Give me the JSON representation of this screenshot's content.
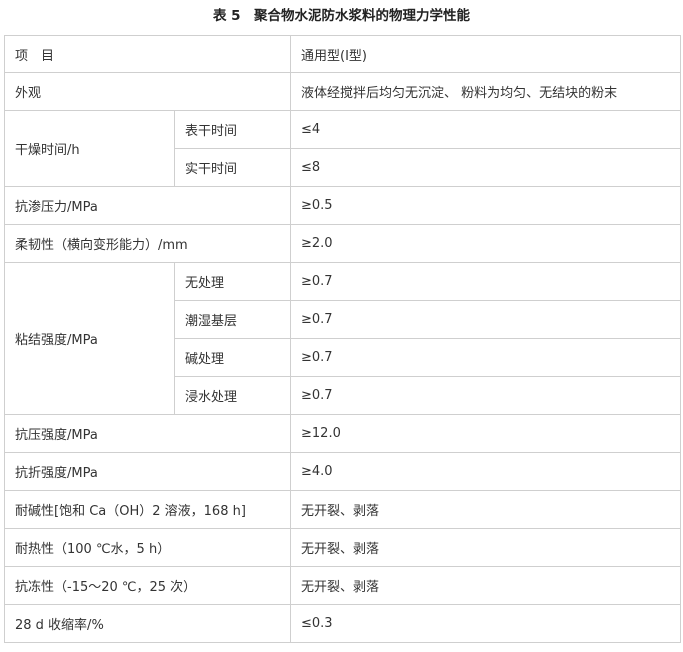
{
  "title": "表 5　聚合物水泥防水浆料的物理力学性能",
  "header": {
    "item": "项　目",
    "type": "通用型(Ⅰ型)"
  },
  "rows": {
    "appearance": {
      "name": "外观",
      "value": "液体经搅拌后均匀无沉淀、 粉料为均匀、无结块的粉末"
    },
    "drying_time": {
      "name": "干燥时间/h",
      "surface_dry": "表干时间",
      "surface_dry_value": "≤4",
      "hard_dry": "实干时间",
      "hard_dry_value": "≤8"
    },
    "impermeability": {
      "name": "抗渗压力/MPa",
      "value": "≥0.5"
    },
    "flexibility": {
      "name": "柔韧性（横向变形能力）/mm",
      "value": "≥2.0"
    },
    "bond_strength": {
      "name": "粘结强度/MPa",
      "untreated": "无处理",
      "untreated_value": "≥0.7",
      "wet_base": "潮湿基层",
      "wet_base_value": "≥0.7",
      "alkali": "碱处理",
      "alkali_value": "≥0.7",
      "immersion": "浸水处理",
      "immersion_value": "≥0.7"
    },
    "compressive": {
      "name": "抗压强度/MPa",
      "value": "≥12.0"
    },
    "flexural": {
      "name": "抗折强度/MPa",
      "value": "≥4.0"
    },
    "alkali_resistance": {
      "name": "耐碱性[饱和 Ca（OH）2 溶液，168 h]",
      "value": "无开裂、剥落"
    },
    "heat_resistance": {
      "name": "耐热性（100 ℃水，5 h）",
      "value": "无开裂、剥落"
    },
    "freeze_resistance": {
      "name": "抗冻性（-15～20 ℃，25 次）",
      "value": "无开裂、剥落"
    },
    "shrinkage": {
      "name": "28 d 收缩率/%",
      "value": "≤0.3"
    }
  }
}
